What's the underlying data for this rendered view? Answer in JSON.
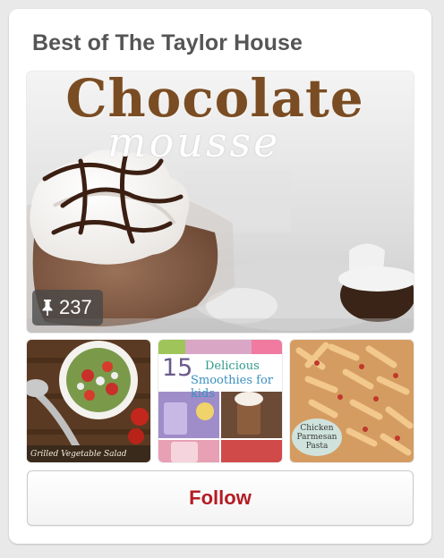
{
  "board": {
    "title": "Best of The Taylor House",
    "pin_count": "237",
    "pin_icon": "pushpin-icon",
    "follow_label": "Follow",
    "follow_color": "#b41c24"
  },
  "cover": {
    "line1": "Chocolate",
    "line2": "mousse"
  },
  "thumbnails": [
    {
      "caption": "Grilled Vegetable Salad"
    },
    {
      "number": "15",
      "line1": "Delicious",
      "line2": "Smoothies for kids"
    },
    {
      "label": "Chicken\nParmesan\nPasta"
    }
  ]
}
